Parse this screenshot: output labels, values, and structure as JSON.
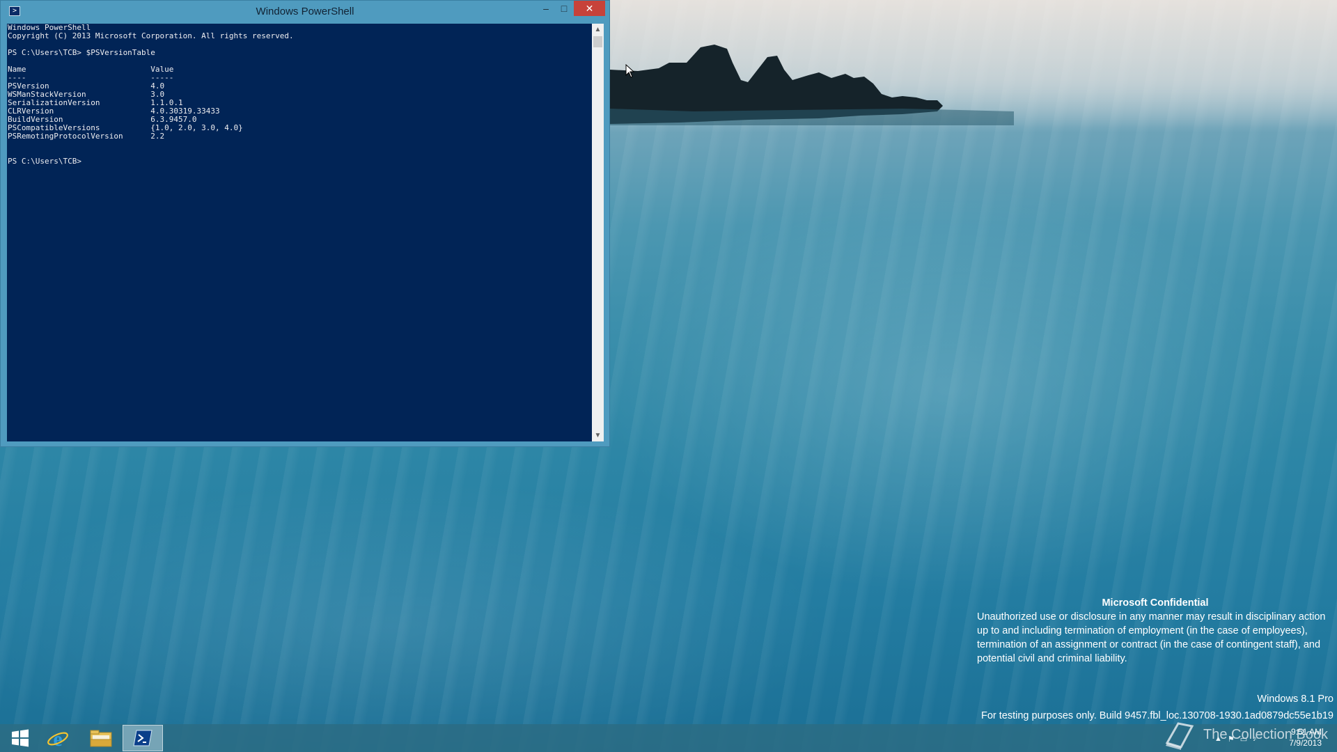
{
  "window": {
    "title": "Windows PowerShell",
    "icon": "powershell-icon",
    "controls": {
      "minimize": "–",
      "maximize": "□",
      "close": "✕"
    }
  },
  "console": {
    "lines": [
      "Windows PowerShell",
      "Copyright (C) 2013 Microsoft Corporation. All rights reserved.",
      "",
      "PS C:\\Users\\TCB> $PSVersionTable",
      "",
      "Name                           Value",
      "----                           -----",
      "PSVersion                      4.0",
      "WSManStackVersion              3.0",
      "SerializationVersion           1.1.0.1",
      "CLRVersion                     4.0.30319.33433",
      "BuildVersion                   6.3.9457.0",
      "PSCompatibleVersions           {1.0, 2.0, 3.0, 4.0}",
      "PSRemotingProtocolVersion      2.2",
      "",
      "",
      "PS C:\\Users\\TCB>"
    ],
    "colors": {
      "background": "#012456",
      "text": "#eeedf0"
    }
  },
  "watermark": {
    "title": "Microsoft Confidential",
    "body": "Unauthorized use or disclosure in any manner may result in disciplinary action up to and including termination of employment (in the case of employees), termination of an assignment or contract (in the case of contingent staff), and potential civil and criminal liability.",
    "edition": "Windows 8.1 Pro",
    "build": "For testing purposes only. Build 9457.fbl_loc.130708-1930.1ad0879dc55e1b19"
  },
  "taskbar": {
    "items": [
      {
        "name": "start-button",
        "icon": "windows-logo-icon"
      },
      {
        "name": "internet-explorer",
        "icon": "internet-explorer-icon"
      },
      {
        "name": "file-explorer",
        "icon": "folder-icon"
      },
      {
        "name": "windows-powershell",
        "icon": "powershell-icon",
        "active": true
      }
    ],
    "tray_icons": [
      "chevron-up-icon",
      "flag-icon",
      "network-icon",
      "volume-icon"
    ],
    "clock": {
      "time": "9:51 AM",
      "date": "7/9/2013"
    },
    "overlay_text": "The Collection Book"
  }
}
